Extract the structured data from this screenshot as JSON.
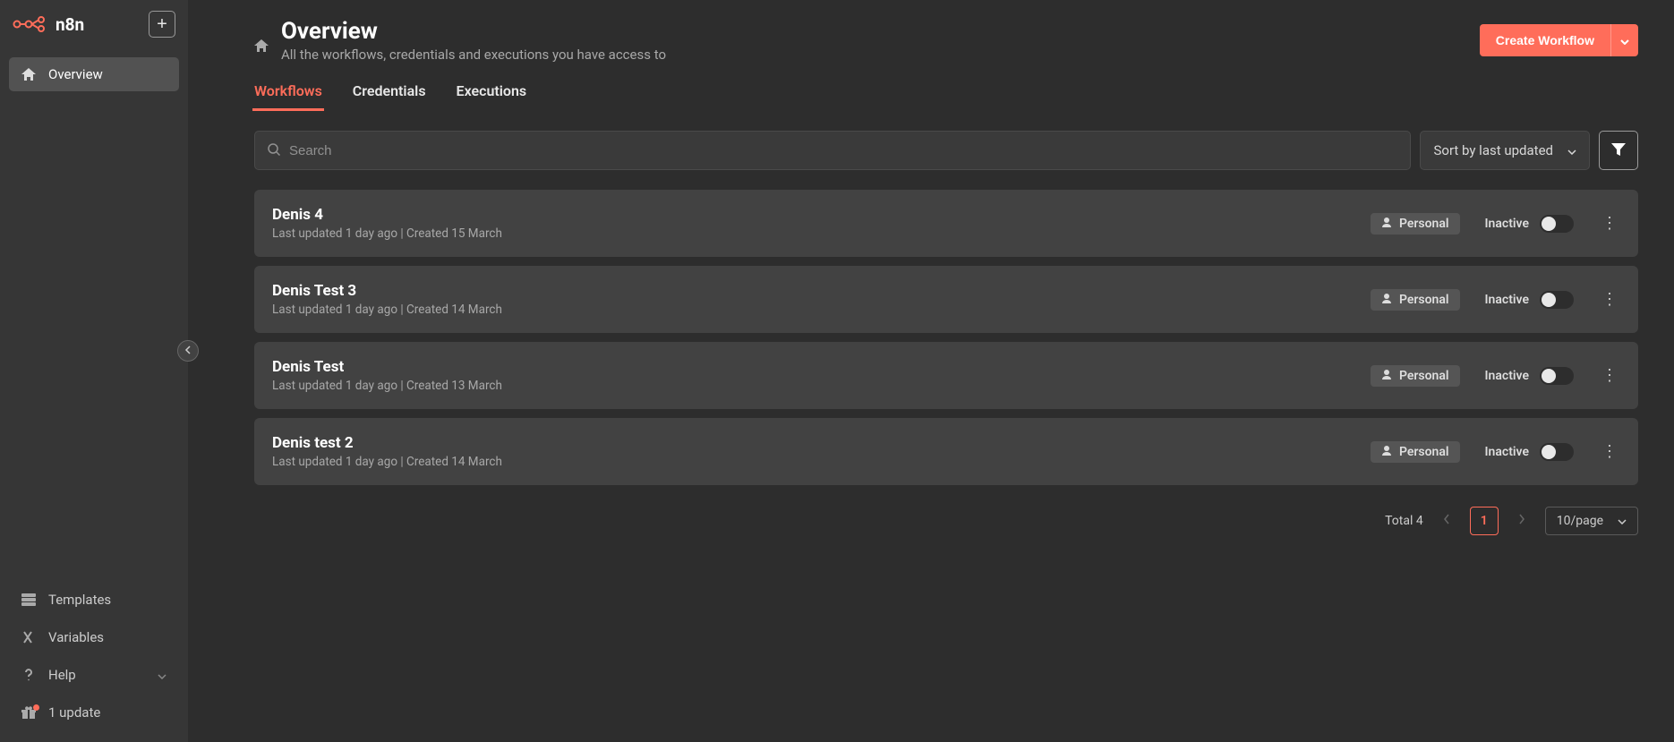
{
  "app": {
    "name": "n8n"
  },
  "sidebar": {
    "items": [
      {
        "label": "Overview",
        "icon": "home"
      }
    ],
    "bottom": [
      {
        "label": "Templates",
        "icon": "layers"
      },
      {
        "label": "Variables",
        "icon": "variable"
      },
      {
        "label": "Help",
        "icon": "question",
        "hasChevron": true
      },
      {
        "label": "1 update",
        "icon": "gift",
        "hasDot": true
      }
    ]
  },
  "page": {
    "title": "Overview",
    "subtitle": "All the workflows, credentials and executions you have access to",
    "createButton": "Create Workflow"
  },
  "tabs": [
    {
      "label": "Workflows",
      "active": true
    },
    {
      "label": "Credentials"
    },
    {
      "label": "Executions"
    }
  ],
  "controls": {
    "searchPlaceholder": "Search",
    "sortLabel": "Sort by last updated"
  },
  "workflows": [
    {
      "name": "Denis 4",
      "meta": "Last updated 1 day ago | Created 15 March",
      "owner": "Personal",
      "status": "Inactive"
    },
    {
      "name": "Denis Test 3",
      "meta": "Last updated 1 day ago | Created 14 March",
      "owner": "Personal",
      "status": "Inactive"
    },
    {
      "name": "Denis Test",
      "meta": "Last updated 1 day ago | Created 13 March",
      "owner": "Personal",
      "status": "Inactive"
    },
    {
      "name": "Denis test 2",
      "meta": "Last updated 1 day ago | Created 14 March",
      "owner": "Personal",
      "status": "Inactive"
    }
  ],
  "pagination": {
    "totalLabel": "Total 4",
    "currentPage": "1",
    "pageSize": "10/page"
  }
}
